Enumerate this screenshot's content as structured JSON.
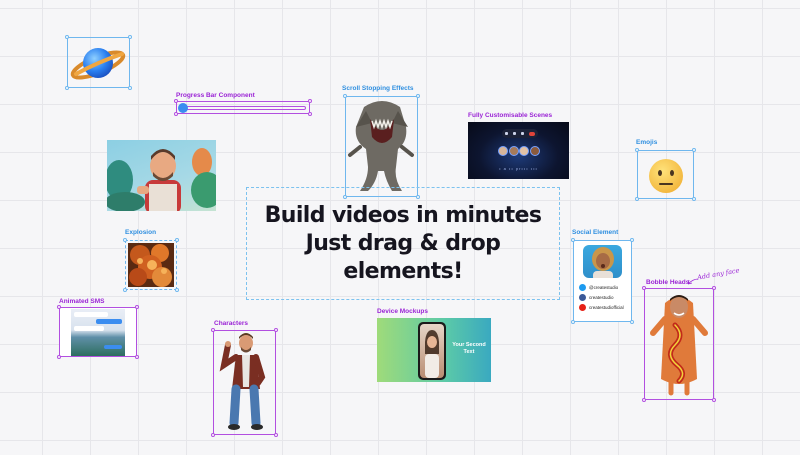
{
  "hero": {
    "line1": "Build videos in minutes",
    "line2": "Just drag & drop",
    "line3": "elements!"
  },
  "labels": {
    "progress_bar": "Progress Bar Component",
    "scroll_stopping": "Scroll Stopping Effects",
    "customisable_scenes": "Fully Customisable Scenes",
    "emojis": "Emojis",
    "explosion": "Explosion",
    "social_element": "Social Element",
    "animated_sms": "Animated SMS",
    "characters": "Characters",
    "device_mockups": "Device Mockups",
    "bobble_heads": "Bobble Heads",
    "add_any_face": "Add any face"
  },
  "social": {
    "twitter": "@createstudio",
    "facebook": "createstudio",
    "youtube": "createstudiofficial"
  },
  "device_mockup_text": "Your Second Text",
  "scene_caption": "• a •• pr••• •••",
  "colors": {
    "label_blue": "#2f8fe0",
    "label_purple": "#9b24d6",
    "twitter": "#1d9bf0",
    "facebook": "#3b5998",
    "youtube": "#e62117"
  }
}
